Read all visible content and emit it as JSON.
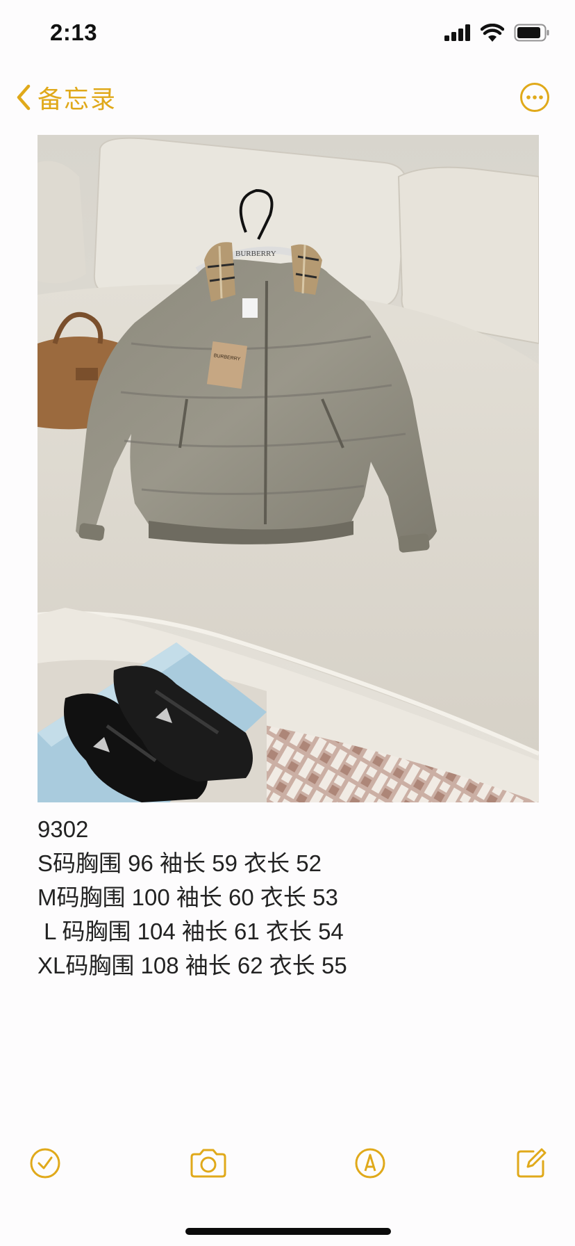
{
  "status_bar": {
    "time": "2:13",
    "icons": [
      "cellular-signal-icon",
      "wifi-icon",
      "battery-icon"
    ]
  },
  "nav": {
    "back_label": "备忘录",
    "back_icon": "chevron-left-icon",
    "more_icon": "ellipsis-circle-icon",
    "accent_color": "#e0a91a"
  },
  "note": {
    "lines": [
      "9302",
      "S码胸围 96 袖长 59 衣长 52",
      "M码胸围 100 袖长 60 衣长 53",
      " L 码胸围 104 袖长 61 衣长 54",
      "XL码胸围 108 袖长 62 衣长 55"
    ]
  },
  "photo": {
    "hanger_text": "BURBERRY",
    "tag_text": "BURBERRY"
  },
  "toolbar": {
    "items": [
      "checklist-icon",
      "camera-icon",
      "markup-pen-icon",
      "compose-icon"
    ]
  }
}
